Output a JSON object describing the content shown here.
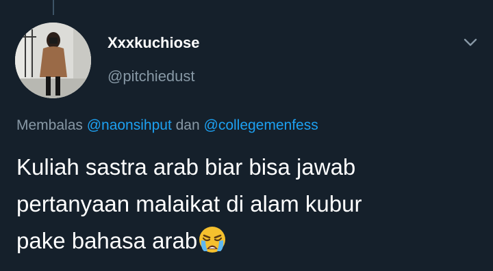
{
  "tweet": {
    "display_name": "Xxxkuchiose",
    "handle": "@pitchiedust",
    "reply_prefix": "Membalas ",
    "reply_mention_1": "@naonsihput",
    "reply_conjunction": " dan ",
    "reply_mention_2": "@collegemenfess",
    "text_lines": [
      "Kuliah sastra arab biar bisa jawab",
      "pertanyaan malaikat di alam kubur",
      "pake bahasa arab"
    ],
    "emoji": "loudly-crying-face"
  },
  "colors": {
    "background": "#15202b",
    "secondary_text": "#8899a6",
    "link": "#1da1f2",
    "emoji_yellow": "#f5c02e"
  },
  "icons": {
    "menu": "chevron-down-icon"
  }
}
